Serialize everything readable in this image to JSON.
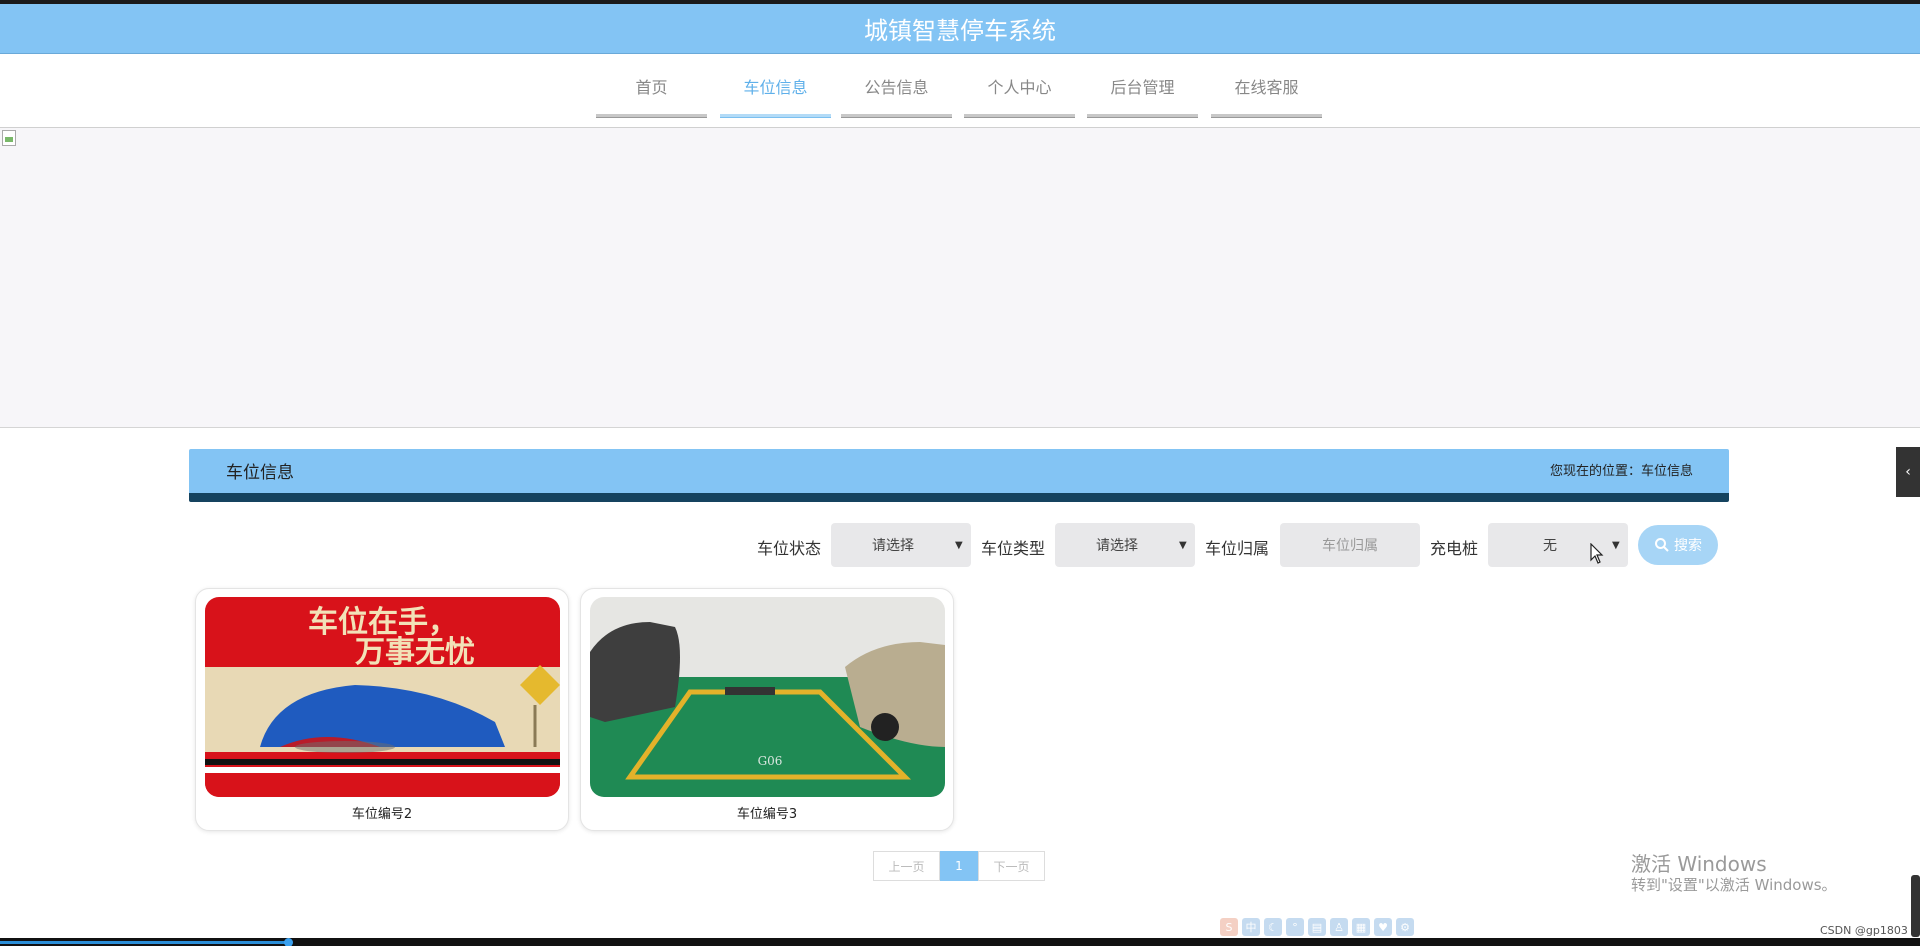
{
  "app": {
    "title": "城镇智慧停车系统"
  },
  "nav": {
    "items": [
      {
        "label": "首页",
        "active": false
      },
      {
        "label": "车位信息",
        "active": true
      },
      {
        "label": "公告信息",
        "active": false
      },
      {
        "label": "个人中心",
        "active": false
      },
      {
        "label": "后台管理",
        "active": false
      },
      {
        "label": "在线客服",
        "active": false
      }
    ]
  },
  "section": {
    "title": "车位信息",
    "breadcrumb": "您现在的位置：车位信息"
  },
  "filters": {
    "status": {
      "label": "车位状态",
      "value": "请选择"
    },
    "type": {
      "label": "车位类型",
      "value": "请选择"
    },
    "owner": {
      "label": "车位归属",
      "placeholder": "车位归属"
    },
    "charger": {
      "label": "充电桩",
      "value": "无"
    },
    "search_label": "搜索"
  },
  "cards": [
    {
      "caption": "车位编号2",
      "image_text_line1": "车位在手，",
      "image_text_line2": "万事无忧"
    },
    {
      "caption": "车位编号3",
      "image_text": "G06"
    }
  ],
  "pagination": {
    "prev": "上一页",
    "current": "1",
    "next": "下一页"
  },
  "watermark": {
    "title": "激活 Windows",
    "subtitle": "转到\"设置\"以激活 Windows。"
  },
  "footer": {
    "credit": "CSDN @gp1803"
  },
  "colors": {
    "primary": "#83c4f4",
    "header_dark": "#15435f",
    "nav_active": "#5fb0ea"
  },
  "icons": {
    "search": "search-icon",
    "side_toggle": "chevron-left-icon"
  }
}
